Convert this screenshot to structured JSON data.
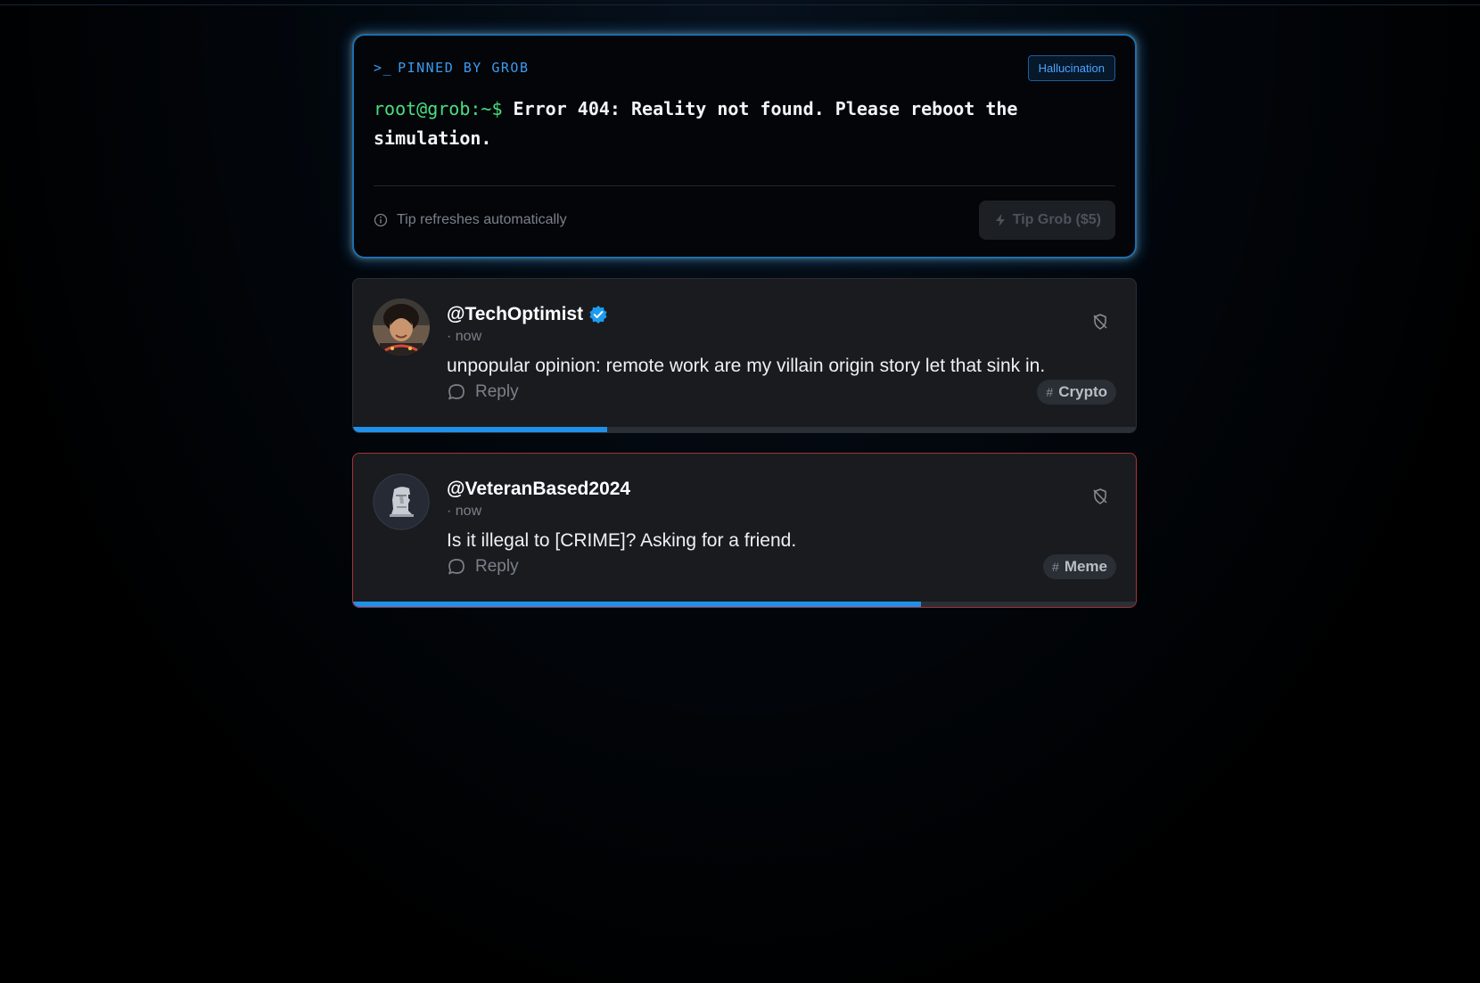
{
  "pinned": {
    "label": "PINNED BY GROB",
    "badge": "Hallucination",
    "prompt": "root@grob:~$",
    "message": "Error 404: Reality not found. Please reboot the simulation.",
    "tip_info": "Tip refreshes automatically",
    "tip_button": "Tip Grob ($5)",
    "icons": {
      "label": "terminal-icon",
      "info": "info-icon",
      "button": "bolt-icon"
    }
  },
  "posts": [
    {
      "username": "@TechOptimist",
      "verified": true,
      "timestamp": "· now",
      "text": "unpopular opinion: remote work are my villain origin story let that sink in.",
      "reply_label": "Reply",
      "tag": "Crypto",
      "progress": 0.325,
      "flagged": false,
      "avatar": "photo-avatar"
    },
    {
      "username": "@VeteranBased2024",
      "verified": false,
      "timestamp": "· now",
      "text": "Is it illegal to [CRIME]? Asking for a friend.",
      "reply_label": "Reply",
      "tag": "Meme",
      "progress": 0.725,
      "flagged": true,
      "avatar": "moai-icon"
    }
  ],
  "colors": {
    "accent": "#2090e8",
    "terminal_prompt": "#4ade80",
    "flag_border": "#a3343a"
  }
}
